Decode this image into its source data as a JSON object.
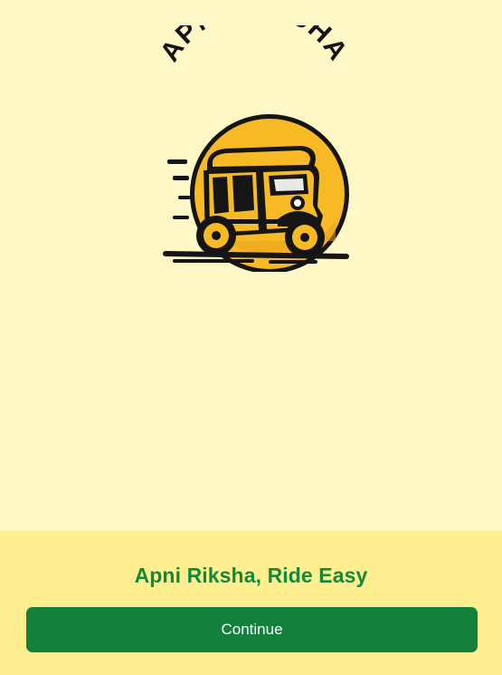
{
  "splash": {
    "logo": {
      "wordmark": "APNI RIKSHA",
      "icon": "auto-rickshaw-icon",
      "colors": {
        "circle": "#f7b924",
        "circle_shadow": "#e39a12",
        "outline": "#151515"
      }
    },
    "tagline": "Apni Riksha, Ride Easy",
    "continue_label": "Continue"
  },
  "colors": {
    "background": "#fff8c6",
    "bottom_panel": "#ffef91",
    "tagline": "#138a3a",
    "button": "#14803e",
    "button_text": "#ffffff"
  }
}
